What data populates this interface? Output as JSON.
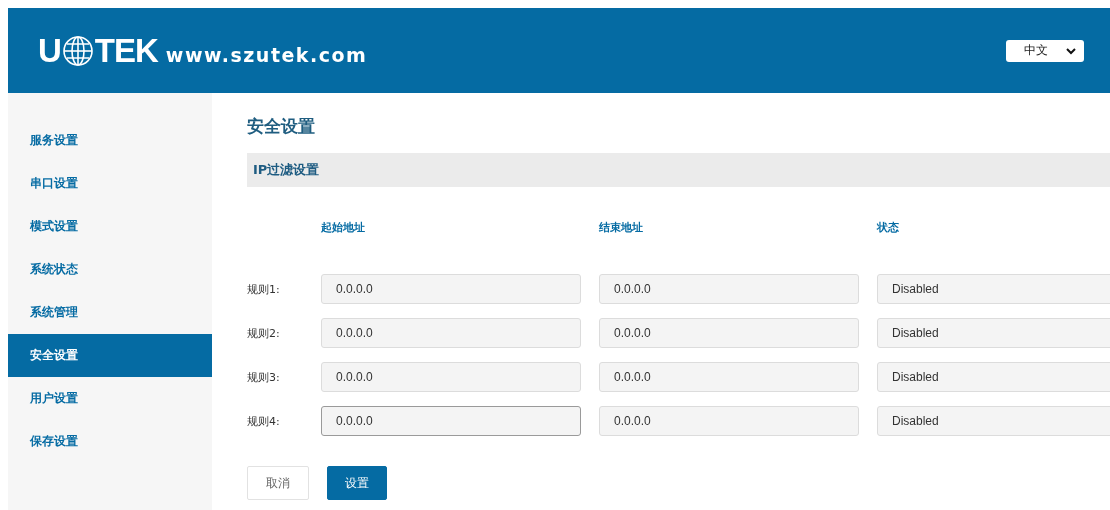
{
  "header": {
    "logo": {
      "left": "U",
      "right": "TEK"
    },
    "site": "www.szutek.com",
    "language": {
      "value": "中文"
    }
  },
  "sidebar": {
    "items": [
      {
        "label": "服务设置",
        "selected": false
      },
      {
        "label": "串口设置",
        "selected": false
      },
      {
        "label": "模式设置",
        "selected": false
      },
      {
        "label": "系统状态",
        "selected": false
      },
      {
        "label": "系统管理",
        "selected": false
      },
      {
        "label": "安全设置",
        "selected": true
      },
      {
        "label": "用户设置",
        "selected": false
      },
      {
        "label": "保存设置",
        "selected": false
      }
    ]
  },
  "page_title": "安全设置",
  "section": {
    "title": "IP过滤设置"
  },
  "table": {
    "columns": [
      "起始地址",
      "结束地址",
      "状态"
    ],
    "rows": [
      {
        "label": "规则1:",
        "start": "0.0.0.0",
        "start_focused": false,
        "end": "0.0.0.0",
        "status": "Disabled"
      },
      {
        "label": "规则2:",
        "start": "0.0.0.0",
        "start_focused": false,
        "end": "0.0.0.0",
        "status": "Disabled"
      },
      {
        "label": "规则3:",
        "start": "0.0.0.0",
        "start_focused": false,
        "end": "0.0.0.0",
        "status": "Disabled"
      },
      {
        "label": "规则4:",
        "start": "0.0.0.0",
        "start_focused": true,
        "end": "0.0.0.0",
        "status": "Disabled"
      }
    ]
  },
  "buttons": [
    {
      "label": "取消",
      "kind": "secondary"
    },
    {
      "label": "设置",
      "kind": "primary"
    }
  ]
}
